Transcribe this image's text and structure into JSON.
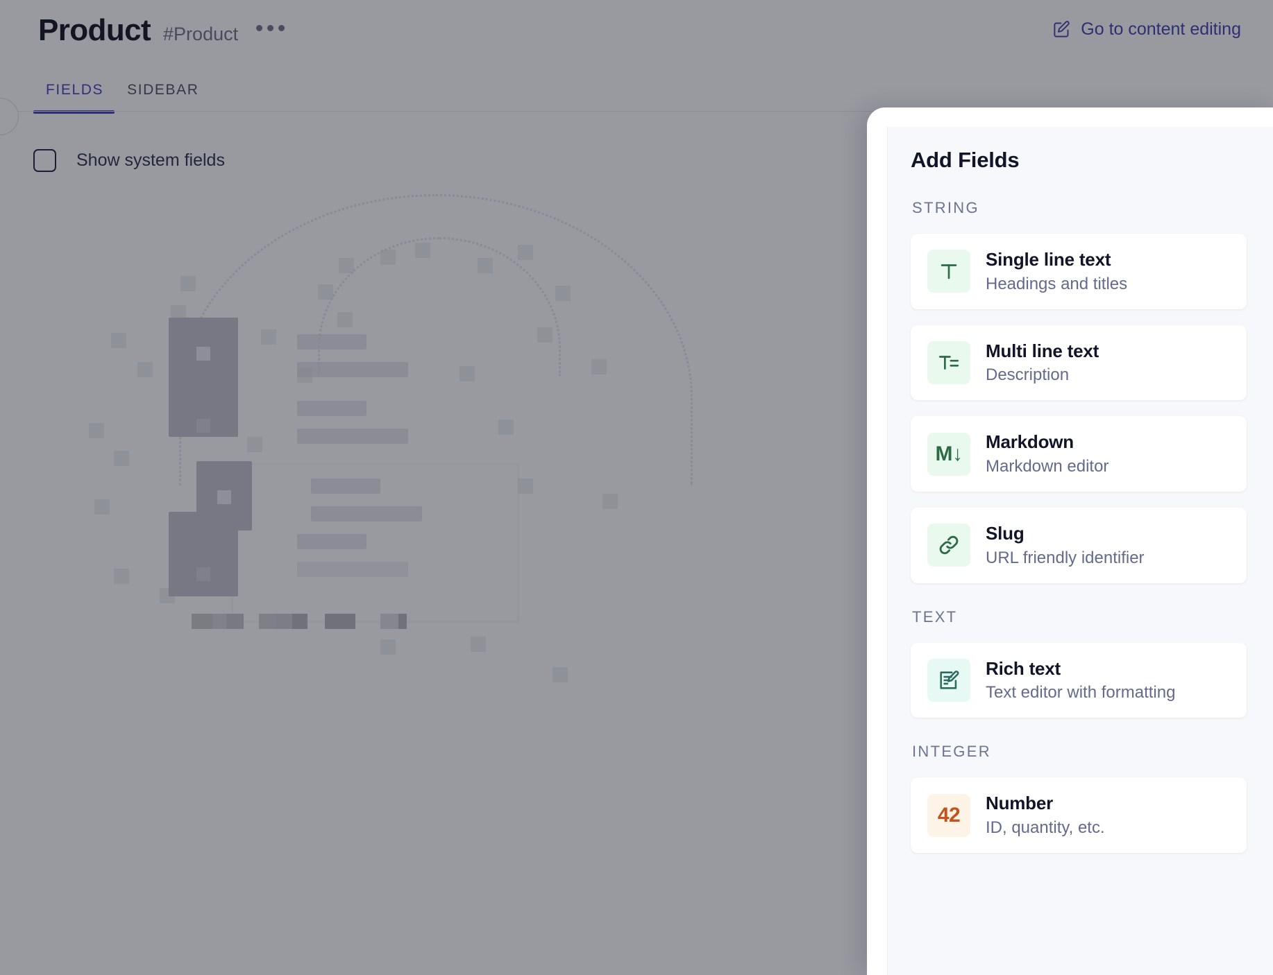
{
  "header": {
    "title": "Product",
    "handle": "#Product",
    "more_menu_label": "•••",
    "content_editing_link": "Go to content editing",
    "edit_icon": "pencil-square-icon"
  },
  "tabs": [
    {
      "label": "FIELDS",
      "active": true
    },
    {
      "label": "SIDEBAR",
      "active": false
    }
  ],
  "toolbar": {
    "show_system_fields_label": "Show system fields",
    "show_system_fields_checked": false
  },
  "panel": {
    "title": "Add Fields",
    "groups": [
      {
        "label": "STRING",
        "fields": [
          {
            "name": "Single line text",
            "description": "Headings and titles",
            "icon": "text-t-icon",
            "icon_glyph": "T",
            "icon_tone": "green"
          },
          {
            "name": "Multi line text",
            "description": "Description",
            "icon": "multiline-text-icon",
            "icon_glyph": "T≡",
            "icon_tone": "green"
          },
          {
            "name": "Markdown",
            "description": "Markdown editor",
            "icon": "markdown-icon",
            "icon_glyph": "M↓",
            "icon_tone": "green"
          },
          {
            "name": "Slug",
            "description": "URL friendly identifier",
            "icon": "link-chain-icon",
            "icon_glyph": "",
            "icon_tone": "green"
          }
        ]
      },
      {
        "label": "TEXT",
        "fields": [
          {
            "name": "Rich text",
            "description": "Text editor with formatting",
            "icon": "rich-text-edit-icon",
            "icon_glyph": "",
            "icon_tone": "teal"
          }
        ]
      },
      {
        "label": "INTEGER",
        "fields": [
          {
            "name": "Number",
            "description": "ID, quantity, etc.",
            "icon": "number-42-icon",
            "icon_glyph": "42",
            "icon_tone": "amber"
          }
        ]
      }
    ]
  },
  "colors": {
    "accent": "#3f3dbb",
    "panel_bg": "#f7f8fb",
    "card_bg": "#ffffff",
    "green_icon_bg": "#e9f9ed",
    "green_icon_fg": "#2d6b46",
    "teal_icon_bg": "#e7f9f4",
    "amber_icon_bg": "#fdf3e7",
    "amber_icon_fg": "#c2551e",
    "title_text": "#121527",
    "muted_text": "#646a8c"
  }
}
